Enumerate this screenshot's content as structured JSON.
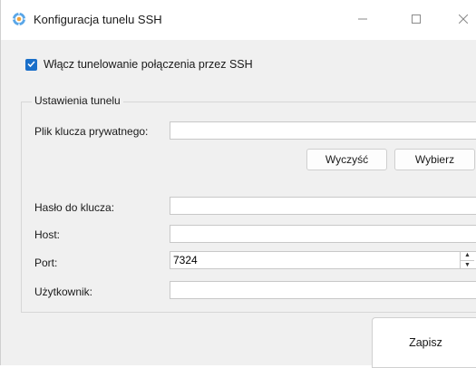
{
  "window": {
    "title": "Konfiguracja tunelu SSH"
  },
  "icons": {
    "app": "ssh-gear-icon",
    "minimize": "minimize-icon",
    "maximize": "maximize-icon",
    "close": "close-icon",
    "check": "checkmark-icon"
  },
  "colors": {
    "accent": "#1a6fc9",
    "window_bg": "#f0f0f0",
    "titlebar_bg": "#ffffff"
  },
  "enable_tunnel": {
    "label": "Włącz tunelowanie połączenia przez SSH",
    "checked": true
  },
  "tunnel_settings": {
    "group_title": "Ustawienia tunelu",
    "private_key": {
      "label": "Plik klucza prywatnego:",
      "value": ""
    },
    "clear_button": "Wyczyść",
    "browse_button": "Wybierz",
    "key_password": {
      "label": "Hasło do klucza:",
      "value": ""
    },
    "host": {
      "label": "Host:",
      "value": ""
    },
    "port": {
      "label": "Port:",
      "value": "7324"
    },
    "user": {
      "label": "Użytkownik:",
      "value": ""
    }
  },
  "save_button": "Zapisz"
}
